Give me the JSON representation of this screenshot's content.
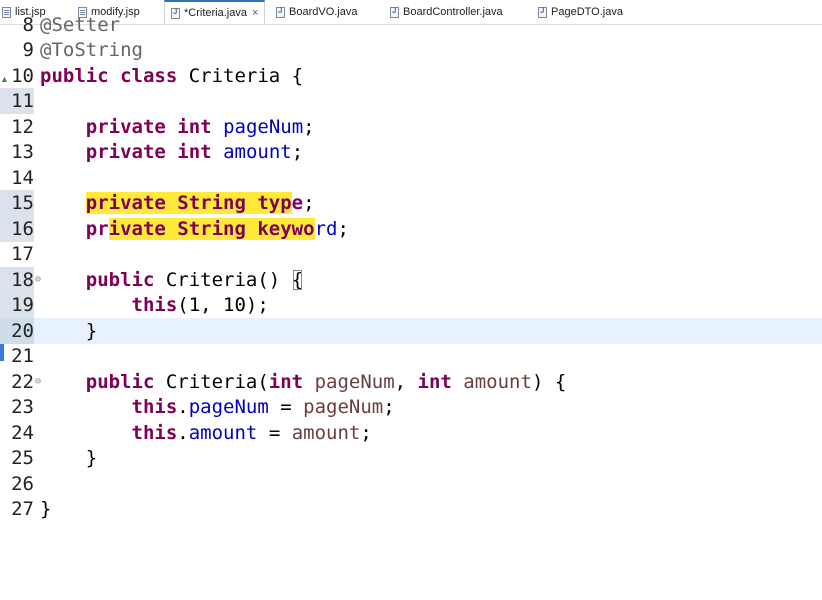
{
  "tabs": [
    {
      "label": "list.jsp",
      "icon": "jsp-file-icon",
      "active": false
    },
    {
      "label": "modify.jsp",
      "icon": "jsp-file-icon",
      "active": false
    },
    {
      "label": "*Criteria.java",
      "icon": "java-file-icon",
      "active": true,
      "close": "×"
    },
    {
      "label": "BoardVO.java",
      "icon": "java-file-icon",
      "active": false
    },
    {
      "label": "BoardController.java",
      "icon": "java-file-icon",
      "active": false
    },
    {
      "label": "PageDTO.java",
      "icon": "java-file-icon",
      "active": false
    }
  ],
  "editor": {
    "line_numbers": [
      "8",
      "9",
      "10",
      "11",
      "12",
      "13",
      "14",
      "15",
      "16",
      "17",
      "18",
      "19",
      "20",
      "21",
      "22",
      "23",
      "24",
      "25",
      "26",
      "27"
    ],
    "fold_markers": {
      "18": "⊖",
      "22": "⊖"
    },
    "current_line": "20",
    "colors": {
      "keyword": "#7f0055",
      "field": "#0000c0",
      "parameter": "#6a3e3e",
      "annotation": "#646464",
      "highlight": "#ffea3a",
      "current_line": "#e8f2fe"
    },
    "tokens": {
      "l8": "@Setter",
      "l9": "@ToString",
      "l10_kw": "public class",
      "l10_rest": " Criteria {",
      "l12_kw": "private int",
      "l12_f": "pageNum",
      "l12_end": ";",
      "l13_kw": "private int",
      "l13_f": "amount",
      "l13_end": ";",
      "l15_a": "private String typ",
      "l15_b": "e",
      "l15_end": ";",
      "l16_a": "pr",
      "l16_b": "ivate String keywo",
      "l16_c": "rd",
      "l16_end": ";",
      "l18_kw": "public",
      "l18_rest": " Criteria() ",
      "l18_brace": "{",
      "l19_kw": "this",
      "l19_rest": "(1, 10);",
      "l20": "}",
      "l22_kw": "public",
      "l22_rest1": " Criteria(",
      "l22_kw2": "int",
      "l22_p1": " pageNum",
      "l22_sep": ", ",
      "l22_kw3": "int",
      "l22_p2": " amount",
      "l22_end": ") {",
      "l23_kw": "this",
      "l23_dot": ".",
      "l23_f": "pageNum",
      "l23_eq": " = ",
      "l23_p": "pageNum",
      "l23_end": ";",
      "l24_kw": "this",
      "l24_dot": ".",
      "l24_f": "amount",
      "l24_eq": " = ",
      "l24_p": "amount",
      "l24_end": ";",
      "l25": "}",
      "l27": "}"
    }
  }
}
